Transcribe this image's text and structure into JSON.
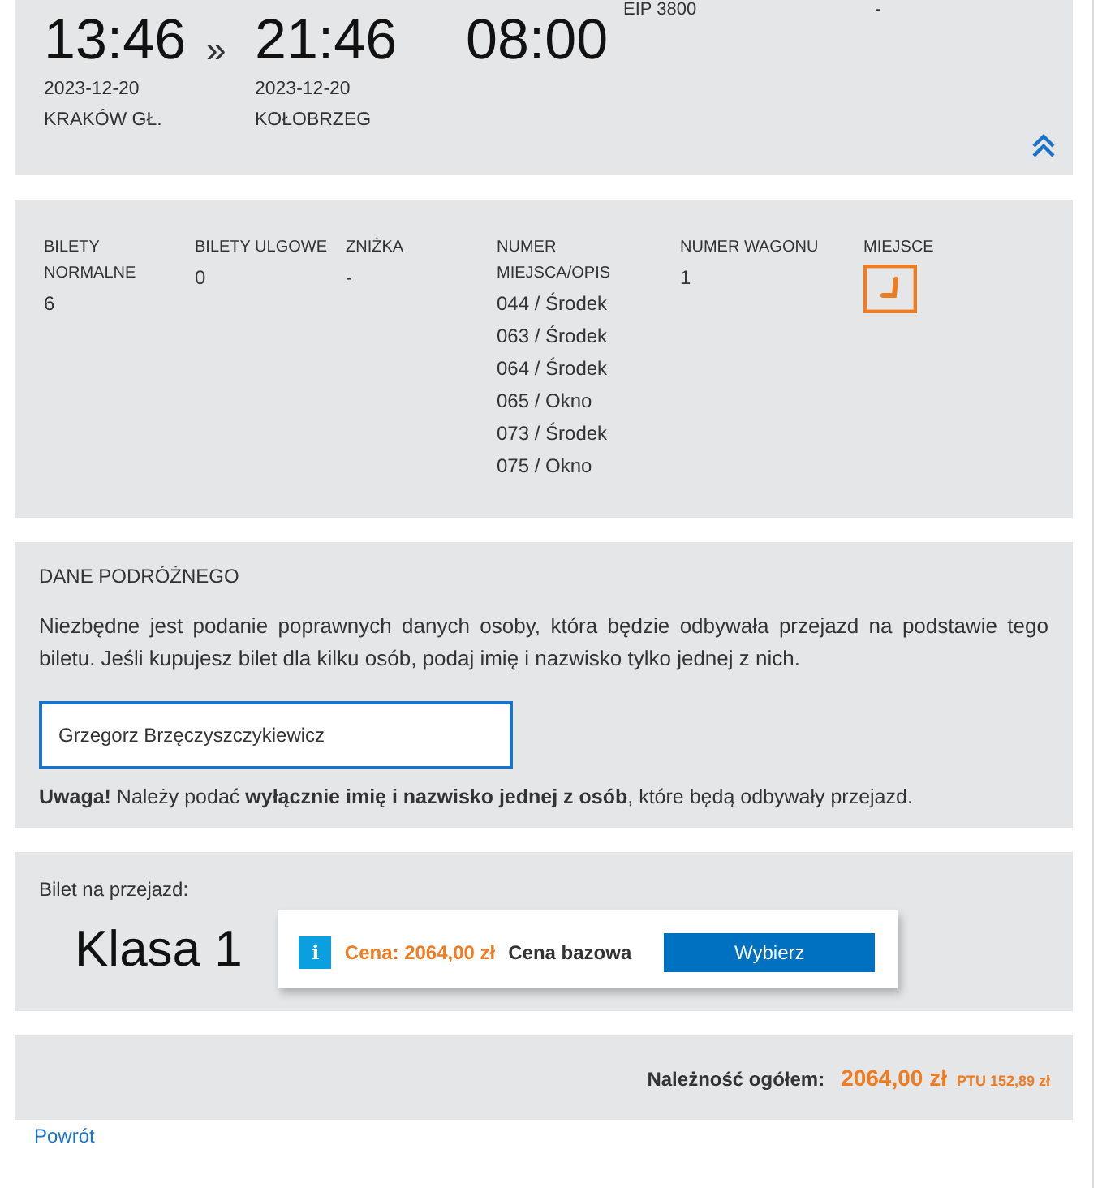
{
  "journey": {
    "train": "EIP 3800",
    "train_extra": "-",
    "departure": {
      "time": "13:46",
      "date": "2023-12-20",
      "station": "KRAKÓW GŁ."
    },
    "separator": "»",
    "arrival": {
      "time": "21:46",
      "date": "2023-12-20",
      "station": "KOŁOBRZEG"
    },
    "duration": "08:00",
    "expanded": true
  },
  "tickets": {
    "columns": [
      {
        "label": "BILETY NORMALNE",
        "values": [
          "6"
        ]
      },
      {
        "label": "BILETY ULGOWE",
        "values": [
          "0"
        ]
      },
      {
        "label": "ZNIŻKA",
        "values": [
          "-"
        ]
      },
      {
        "label": "NUMER MIEJSCA/OPIS",
        "values": [
          "044 / Środek",
          "063 / Środek",
          "064 / Środek",
          "065 / Okno",
          "073 / Środek",
          "075 / Okno"
        ]
      },
      {
        "label": "NUMER WAGONU",
        "values": [
          "1"
        ]
      },
      {
        "label": "MIEJSCE"
      }
    ]
  },
  "passenger": {
    "title": "DANE PODRÓŻNEGO",
    "description": "Niezbędne jest podanie poprawnych danych osoby, która będzie odbywała przejazd na podstawie tego biletu. Jeśli kupujesz bilet dla kilku osób, podaj imię i nazwisko tylko jednej z nich.",
    "name_value": "Grzegorz Brzęczyszczykiewicz",
    "warning": "**Uwaga!** Należy podać **wyłącznie imię i nazwisko jednej z osób**, które będą odbywały przejazd."
  },
  "fare": {
    "label": "Bilet na przejazd:",
    "class": "Klasa 1",
    "info": "i",
    "price": "Cena: 2064,00 zł",
    "price_type": "Cena bazowa",
    "button": "Wybierz"
  },
  "total": {
    "label": "Należność ogółem:",
    "amount": "2064,00 zł",
    "vat": "PTU 152,89 zł"
  },
  "back_link": "Powrót"
}
